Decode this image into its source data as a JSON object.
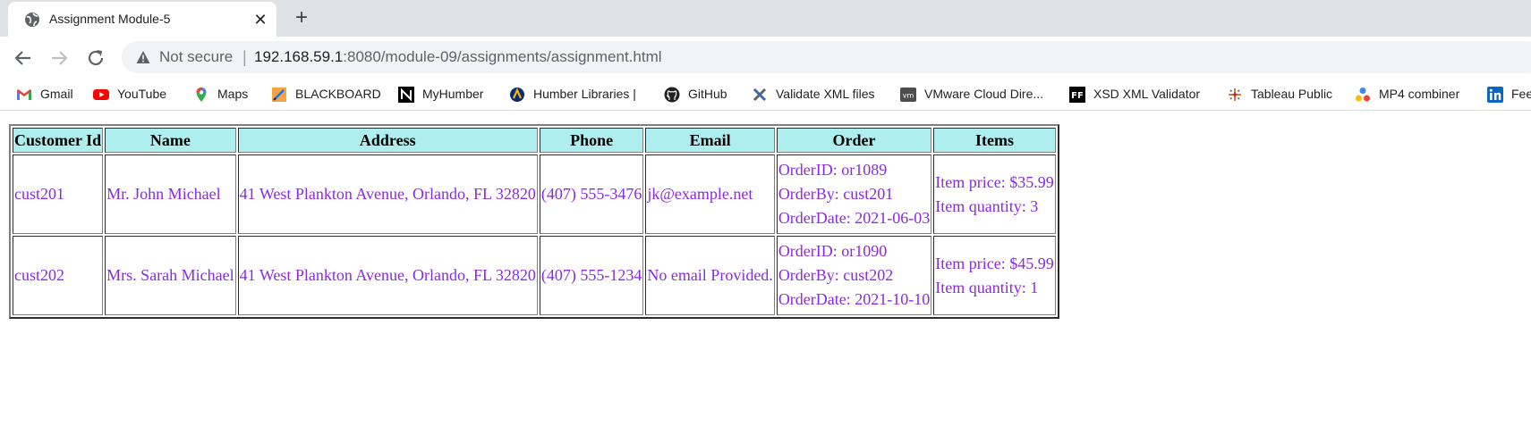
{
  "tab": {
    "title": "Assignment Module-5",
    "close": "✕",
    "new_tab": "+"
  },
  "omnibox": {
    "security_label": "Not secure",
    "separator": "|",
    "url_host": "192.168.59.1",
    "url_path": ":8080/module-09/assignments/assignment.html"
  },
  "bookmarks": [
    {
      "label": "Gmail",
      "icon": "gmail-icon"
    },
    {
      "label": "YouTube",
      "icon": "youtube-icon"
    },
    {
      "label": "Maps",
      "icon": "maps-icon"
    },
    {
      "label": "BLACKBOARD",
      "icon": "blackboard-icon"
    },
    {
      "label": "MyHumber",
      "icon": "myhumber-icon"
    },
    {
      "label": "Humber Libraries |",
      "icon": "humber-libraries-icon"
    },
    {
      "label": "GitHub",
      "icon": "github-icon"
    },
    {
      "label": "Validate XML files",
      "icon": "validate-xml-icon"
    },
    {
      "label": "VMware Cloud Dire...",
      "icon": "vmware-icon"
    },
    {
      "label": "XSD XML Validator",
      "icon": "xsd-validator-icon"
    },
    {
      "label": "Tableau Public",
      "icon": "tableau-icon"
    },
    {
      "label": "MP4 combiner",
      "icon": "mp4-combiner-icon"
    },
    {
      "label": "Fee",
      "icon": "linkedin-icon"
    }
  ],
  "table": {
    "headers": [
      "Customer Id",
      "Name",
      "Address",
      "Phone",
      "Email",
      "Order",
      "Items"
    ],
    "rows": [
      {
        "customer_id": "cust201",
        "name": "Mr. John Michael",
        "address": "41 West Plankton Avenue, Orlando, FL 32820",
        "phone": "(407) 555-3476",
        "email": "jk@example.net",
        "order": {
          "id": "OrderID: or1089",
          "by": "OrderBy: cust201",
          "date": "OrderDate: 2021-06-03"
        },
        "items": {
          "price": "Item price: $35.99",
          "quantity": "Item quantity: 3"
        }
      },
      {
        "customer_id": "cust202",
        "name": "Mrs. Sarah Michael",
        "address": "41 West Plankton Avenue, Orlando, FL 32820",
        "phone": "(407) 555-1234",
        "email": "No email Provided.",
        "order": {
          "id": "OrderID: or1090",
          "by": "OrderBy: cust202",
          "date": "OrderDate: 2021-10-10"
        },
        "items": {
          "price": "Item price: $45.99",
          "quantity": "Item quantity: 1"
        }
      }
    ]
  },
  "colors": {
    "header_bg": "#afeeee",
    "cell_text": "#8a2be2"
  }
}
